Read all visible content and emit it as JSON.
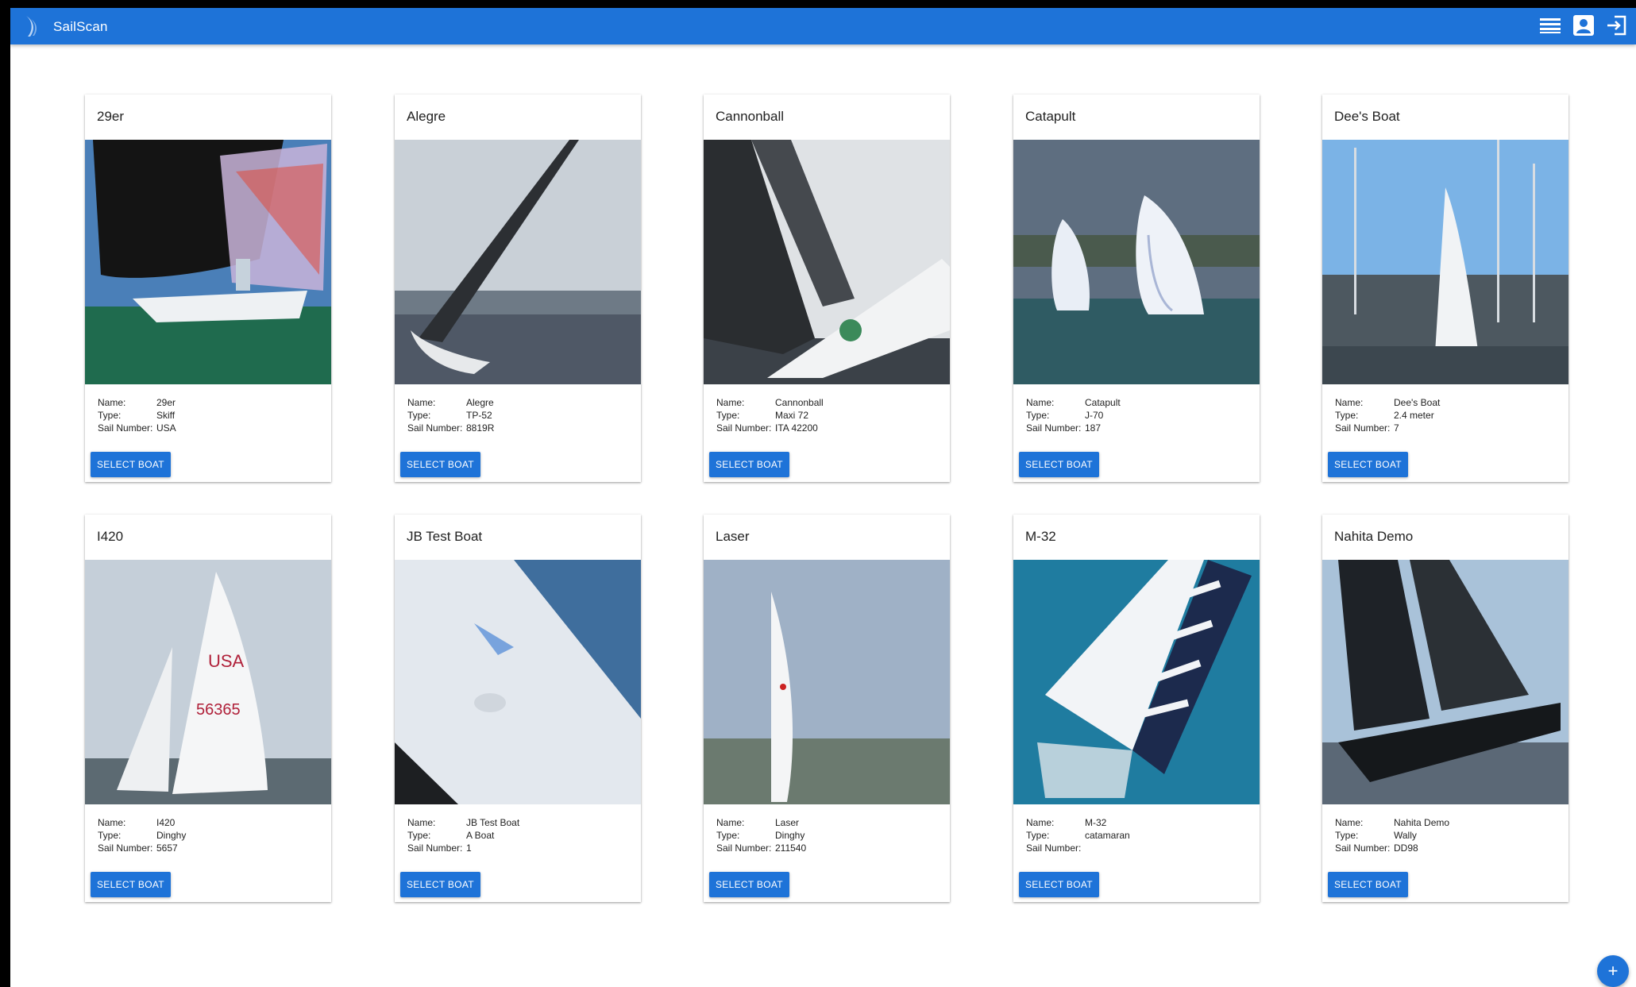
{
  "app": {
    "title": "SailScan",
    "toolbar_icons": [
      "menu-icon",
      "account-icon",
      "logout-icon"
    ],
    "accent_color": "#1e73d8"
  },
  "boats": [
    {
      "title": "29er",
      "name": "29er",
      "type": "Skiff",
      "sail_number": "USA",
      "image": "spinnaker-skiff-photo"
    },
    {
      "title": "Alegre",
      "name": "Alegre",
      "type": "TP-52",
      "sail_number": "8819R",
      "image": "heeling-yacht-photo"
    },
    {
      "title": "Cannonball",
      "name": "Cannonball",
      "type": "Maxi 72",
      "sail_number": "ITA 42200",
      "image": "maxi-bow-photo"
    },
    {
      "title": "Catapult",
      "name": "Catapult",
      "type": "J-70",
      "sail_number": "187",
      "image": "two-sailboats-photo"
    },
    {
      "title": "Dee's Boat",
      "name": "Dee's Boat",
      "type": "2.4 meter",
      "sail_number": "7",
      "image": "marina-sailboat-photo"
    },
    {
      "title": "I420",
      "name": "I420",
      "type": "Dinghy",
      "sail_number": "5657",
      "image": "dinghy-sail-photo"
    },
    {
      "title": "JB Test Boat",
      "name": "JB Test Boat",
      "type": "A Boat",
      "sail_number": "1",
      "image": "sail-closeup-photo"
    },
    {
      "title": "Laser",
      "name": "Laser",
      "type": "Dinghy",
      "sail_number": "211540",
      "image": "laser-dinghy-photo"
    },
    {
      "title": "M-32",
      "name": "M-32",
      "type": "catamaran",
      "sail_number": "",
      "image": "catamaran-aerial-photo"
    },
    {
      "title": "Nahita Demo",
      "name": "Nahita Demo",
      "type": "Wally",
      "sail_number": "DD98",
      "image": "dark-yacht-photo"
    }
  ],
  "labels": {
    "name": "Name:",
    "type": "Type:",
    "sail_number": "Sail Number:",
    "select_button": "SELECT BOAT"
  },
  "fab": {
    "label": "+",
    "icon": "add-icon"
  }
}
